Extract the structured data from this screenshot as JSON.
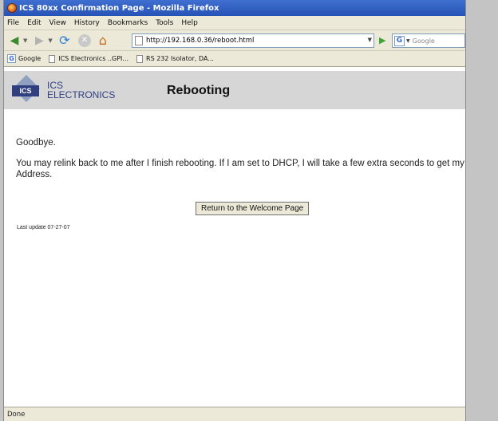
{
  "window": {
    "title": "ICS 80xx Confirmation Page - Mozilla Firefox"
  },
  "menu": [
    "File",
    "Edit",
    "View",
    "History",
    "Bookmarks",
    "Tools",
    "Help"
  ],
  "nav": {
    "url": "http://192.168.0.36/reboot.html",
    "search_placeholder": "Google",
    "icons": [
      "back-arrow-icon",
      "forward-arrow-icon",
      "reload-icon",
      "stop-icon",
      "home-icon",
      "go-icon",
      "google-search-icon"
    ]
  },
  "bookmarks": [
    {
      "label": "Google",
      "icon": "google-icon"
    },
    {
      "label": "ICS Electronics ..GPI...",
      "icon": "page-icon"
    },
    {
      "label": "RS 232 Isolator, DA...",
      "icon": "page-icon"
    }
  ],
  "page": {
    "logo_tag": "ICS",
    "company_line1": "ICS",
    "company_line2": "ELECTRONICS",
    "heading": "Rebooting",
    "goodbye": "Goodbye.",
    "relink": "You may relink back to me after I finish rebooting. If I am set to DHCP, I will take a few extra seconds to get my n Address.",
    "button_label": "Return to the Welcome Page",
    "last_update": "Last update 07-27-07"
  },
  "status": "Done",
  "colors": {
    "brand": "#2f3f80",
    "header_bg": "#d6d6d6",
    "chrome": "#ece9d8",
    "titlebar": "#2753b5"
  }
}
